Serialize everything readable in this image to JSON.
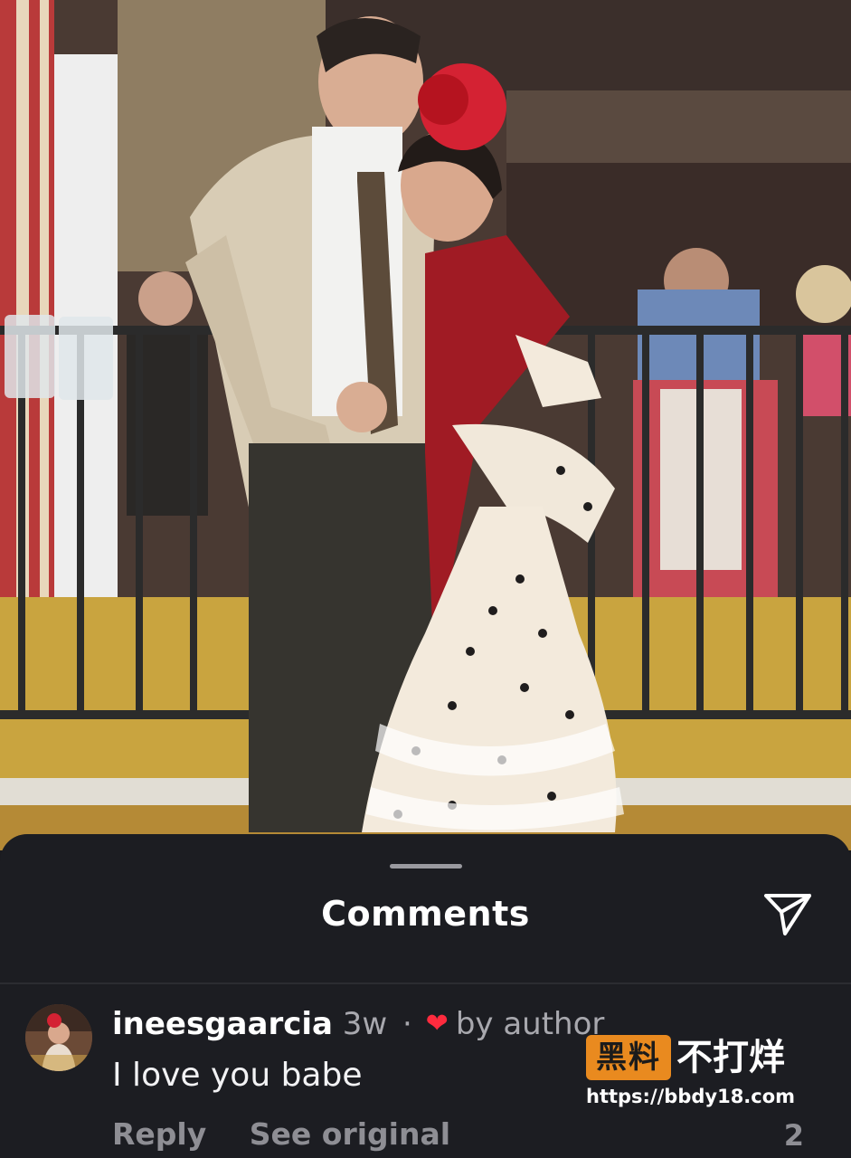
{
  "sheet": {
    "title": "Comments",
    "share_icon": "paper-plane-icon"
  },
  "comment": {
    "username": "ineesgaarcia",
    "age": "3w",
    "separator": "·",
    "liked_by_author_icon": "heart-icon",
    "liked_by_author_text": "by author",
    "text": "I love you babe",
    "reply_label": "Reply",
    "see_original_label": "See original",
    "like_count": "2"
  },
  "watermark": {
    "badge": "黑料",
    "text": "不打烊",
    "url": "https://bbdy18.com"
  },
  "colors": {
    "sheet_background": "#1c1d22",
    "heart": "#ff2b3e",
    "watermark_badge": "#e98a1f"
  }
}
